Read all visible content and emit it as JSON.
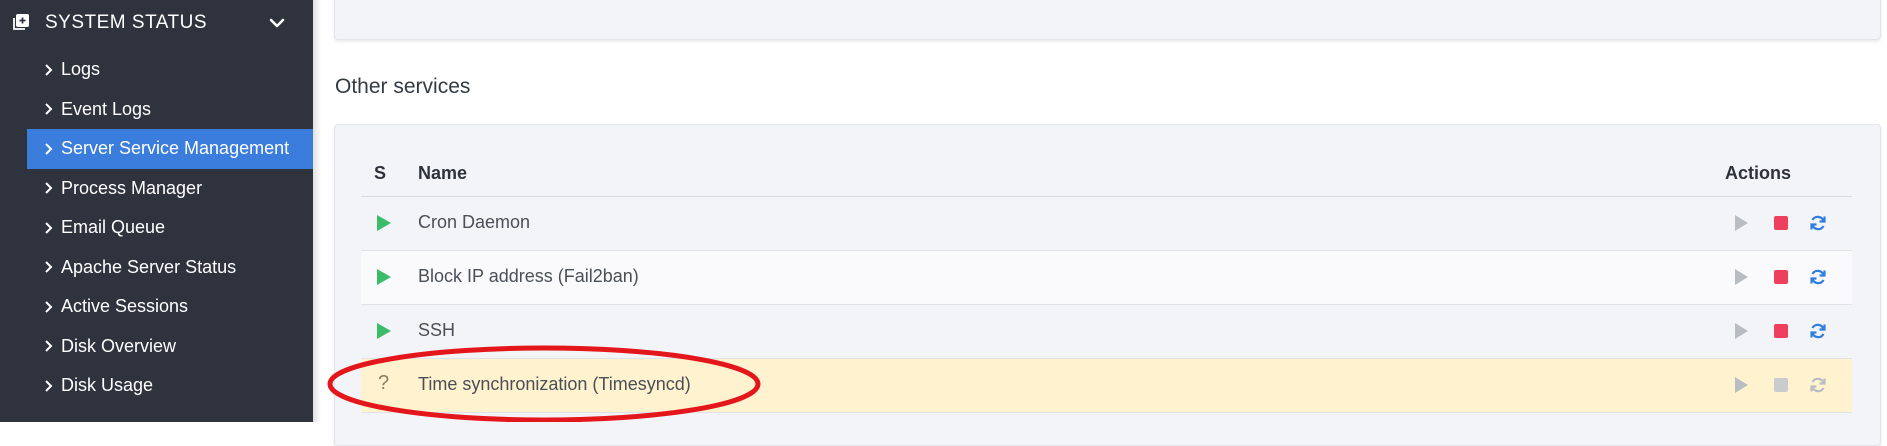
{
  "sidebar": {
    "header": {
      "label": "SYSTEM STATUS",
      "icon": "plus-square-icon"
    },
    "items": [
      {
        "label": "Logs",
        "active": false
      },
      {
        "label": "Event Logs",
        "active": false
      },
      {
        "label": "Server Service Management",
        "active": true
      },
      {
        "label": "Process Manager",
        "active": false
      },
      {
        "label": "Email Queue",
        "active": false
      },
      {
        "label": "Apache Server Status",
        "active": false
      },
      {
        "label": "Active Sessions",
        "active": false
      },
      {
        "label": "Disk Overview",
        "active": false
      },
      {
        "label": "Disk Usage",
        "active": false
      }
    ]
  },
  "main": {
    "section_title": "Other services",
    "table": {
      "headers": {
        "status": "S",
        "name": "Name",
        "actions": "Actions"
      },
      "rows": [
        {
          "name": "Cron Daemon",
          "status": "running"
        },
        {
          "name": "Block IP address (Fail2ban)",
          "status": "running"
        },
        {
          "name": "SSH",
          "status": "running"
        },
        {
          "name": "Time synchronization (Timesyncd)",
          "status": "unknown",
          "status_symbol": "?"
        }
      ]
    }
  },
  "colors": {
    "sidebar_bg": "#2f333e",
    "active_item": "#3b7ddd",
    "running_green": "#3cbc6a",
    "stop_red": "#ee3f5c",
    "restart_blue": "#2f7de1",
    "disabled_gray": "#b8bcc3",
    "warning_row": "#fff2cf",
    "annotation_red": "#e3171b"
  }
}
